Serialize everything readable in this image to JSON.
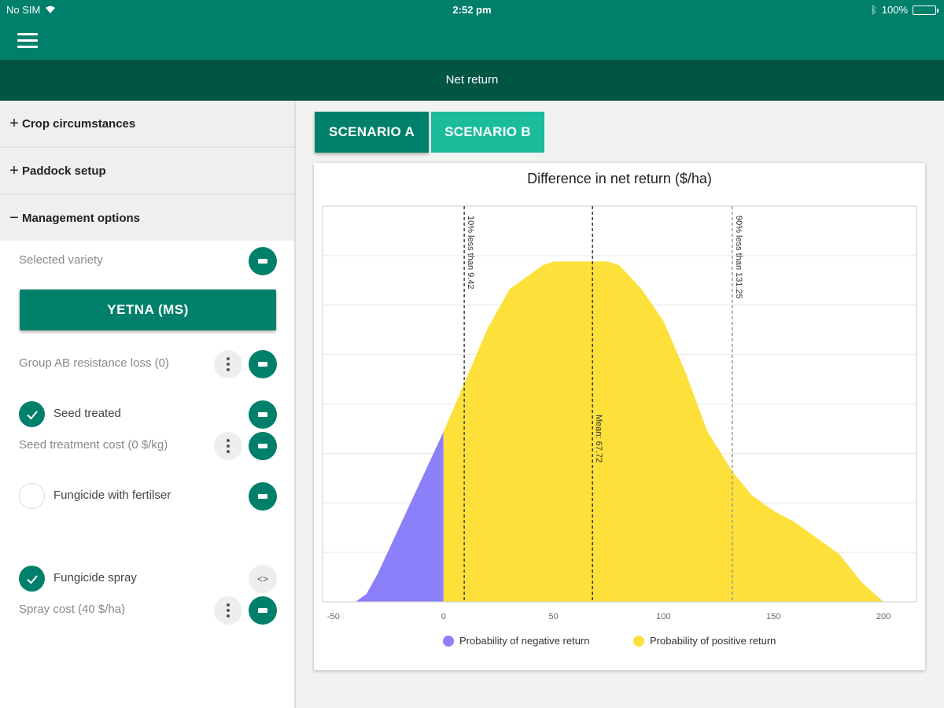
{
  "status_bar": {
    "carrier": "No SIM",
    "time": "2:52 pm",
    "battery": "100%"
  },
  "title_bar": {
    "title": "Net return"
  },
  "sidebar": {
    "sections": [
      {
        "sign": "+",
        "label": "Crop circumstances"
      },
      {
        "sign": "+",
        "label": "Paddock setup"
      },
      {
        "sign": "−",
        "label": "Management options"
      }
    ],
    "selected_variety_label": "Selected variety",
    "variety_button": "YETNA (MS)",
    "group_ab_label": "Group AB resistance loss (0)",
    "seed_treated_label": "Seed treated",
    "seed_treated_checked": true,
    "seed_treatment_cost_label": "Seed treatment cost (0 $/kg)",
    "fungicide_fertiliser_label": "Fungicide with fertilser",
    "fungicide_fertiliser_checked": false,
    "fungicide_spray_label": "Fungicide spray",
    "fungicide_spray_checked": true,
    "spray_cost_label": "Spray cost (40 $/ha)"
  },
  "tabs": [
    {
      "label": "SCENARIO A",
      "active": true
    },
    {
      "label": "SCENARIO B",
      "active": false
    }
  ],
  "colors": {
    "primary": "#00806a",
    "dark": "#005543",
    "tab_b": "#1abc9c",
    "negative": "#8b80f9",
    "positive": "#fde13a"
  },
  "chart_data": {
    "type": "area",
    "title": "Difference in net return ($/ha)",
    "xlim": [
      -55,
      215
    ],
    "ylim": [
      0,
      1.0
    ],
    "x_ticks": [
      "-50",
      "0",
      "50",
      "100",
      "150",
      "200"
    ],
    "x_tick_values": [
      -50,
      0,
      50,
      100,
      150,
      200
    ],
    "grid": true,
    "series": [
      {
        "name": "Probability of negative return",
        "color": "#8b80f9",
        "x": [
          -53,
          -40,
          -35,
          -30,
          -20,
          -10,
          0
        ],
        "y": [
          0,
          0,
          0.02,
          0.07,
          0.19,
          0.31,
          0.43
        ]
      },
      {
        "name": "Probability of positive return",
        "color": "#fde13a",
        "x": [
          0,
          10,
          20,
          30,
          40,
          45,
          50,
          60,
          75,
          80,
          90,
          100,
          110,
          120,
          131.25,
          140,
          150,
          160,
          170,
          180,
          190,
          200
        ],
        "y": [
          0.43,
          0.56,
          0.69,
          0.79,
          0.83,
          0.85,
          0.86,
          0.86,
          0.86,
          0.85,
          0.79,
          0.71,
          0.58,
          0.43,
          0.33,
          0.27,
          0.23,
          0.2,
          0.16,
          0.12,
          0.05,
          0
        ]
      }
    ],
    "reference_lines": [
      {
        "x": 9.42,
        "label": "10% less than 9.42",
        "color": "#444"
      },
      {
        "x": 67.72,
        "label": "Mean: 67.72",
        "color": "#333"
      },
      {
        "x": 131.25,
        "label": "90% less than 131.25",
        "color": "#999"
      }
    ],
    "legend_position": "bottom"
  }
}
